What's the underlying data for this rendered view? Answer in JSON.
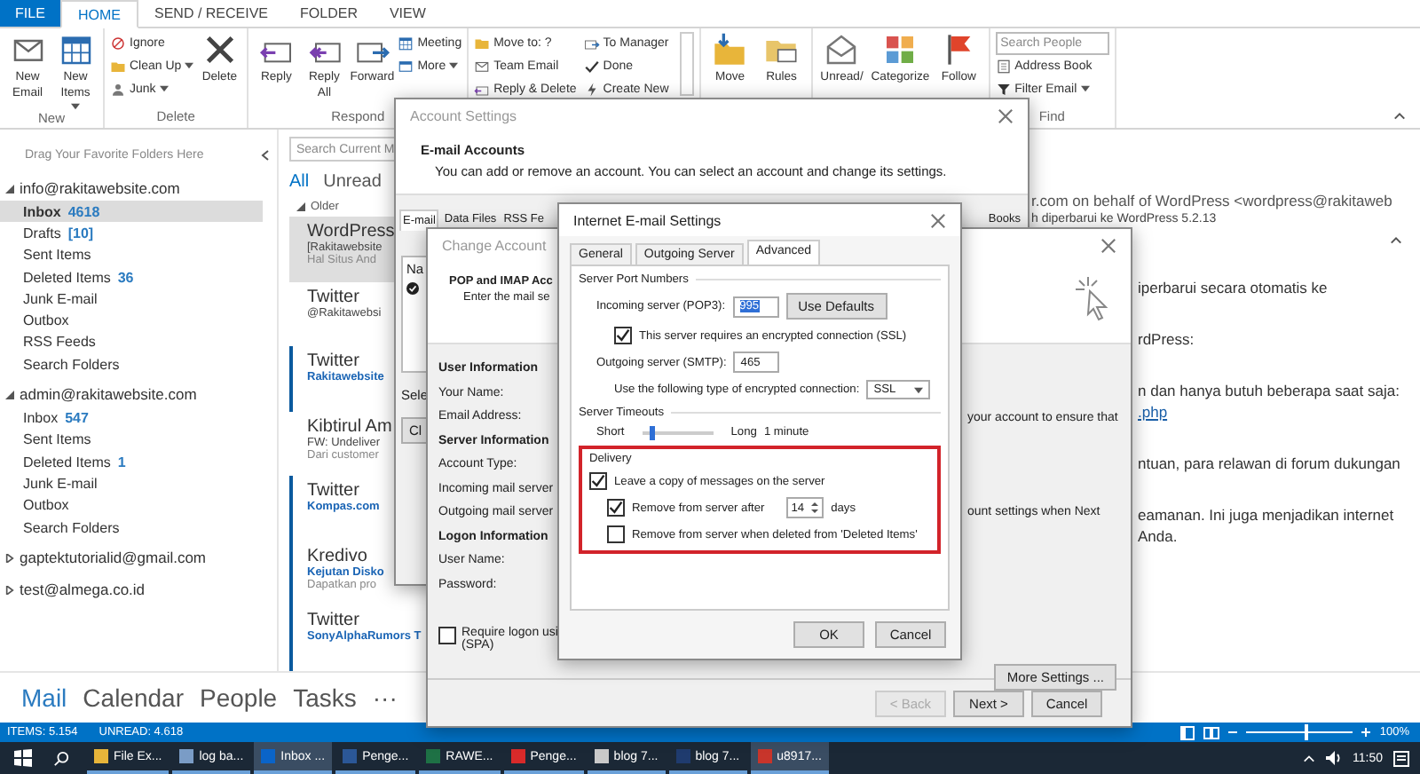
{
  "ribbon": {
    "file_tab": "FILE",
    "tabs": [
      {
        "label": "HOME",
        "selected": true
      },
      {
        "label": "SEND / RECEIVE",
        "selected": false
      },
      {
        "label": "FOLDER",
        "selected": false
      },
      {
        "label": "VIEW",
        "selected": false
      }
    ],
    "groups": [
      {
        "label": "New",
        "items": [
          {
            "kind": "large",
            "label": "New Email",
            "menu": false
          },
          {
            "kind": "large",
            "label": "New Items",
            "menu": true
          }
        ]
      },
      {
        "label": "Delete",
        "items": [
          {
            "kind": "small",
            "label": "Ignore",
            "menu": false
          },
          {
            "kind": "small",
            "label": "Clean Up",
            "menu": true
          },
          {
            "kind": "small",
            "label": "Junk",
            "menu": true
          },
          {
            "kind": "large",
            "label": "Delete",
            "menu": false
          }
        ]
      },
      {
        "label": "Respond",
        "items": [
          {
            "kind": "large",
            "label": "Reply",
            "menu": false
          },
          {
            "kind": "large",
            "label": "Reply All",
            "menu": false
          },
          {
            "kind": "large",
            "label": "Forward",
            "menu": false
          },
          {
            "kind": "small",
            "label": "Meeting",
            "menu": false
          },
          {
            "kind": "small",
            "label": "More",
            "menu": true
          }
        ]
      },
      {
        "items": [
          {
            "kind": "small",
            "label": "Move to: ?",
            "menu": false
          },
          {
            "kind": "small",
            "label": "Team Email",
            "menu": false
          },
          {
            "kind": "small",
            "label": "Reply & Delete",
            "menu": false
          },
          {
            "kind": "small",
            "label": "To Manager",
            "menu": false
          },
          {
            "kind": "small",
            "label": "Done",
            "menu": false
          },
          {
            "kind": "small",
            "label": "Create New",
            "menu": false
          }
        ]
      },
      {
        "items": [
          {
            "kind": "large",
            "label": "Move",
            "menu": false
          },
          {
            "kind": "large",
            "label": "Rules",
            "menu": false
          }
        ]
      },
      {
        "items": [
          {
            "kind": "large",
            "label": "Unread/",
            "menu": false
          },
          {
            "kind": "large",
            "label": "Categorize",
            "menu": false
          },
          {
            "kind": "large",
            "label": "Follow",
            "menu": false
          }
        ]
      },
      {
        "label": "Find",
        "items": [
          {
            "kind": "search",
            "placeholder": "Search People"
          },
          {
            "kind": "small",
            "label": "Address Book",
            "menu": false
          },
          {
            "kind": "small",
            "label": "Filter Email",
            "menu": true
          }
        ]
      }
    ]
  },
  "folder_pane": {
    "favorites_hint": "Drag Your Favorite Folders Here",
    "accounts": [
      {
        "name": "info@rakitawebsite.com",
        "expanded": true,
        "children": [
          {
            "label": "Inbox",
            "count": "4618",
            "selected": true
          },
          {
            "label": "Drafts",
            "count": "[10]",
            "selected": false
          },
          {
            "label": "Sent Items",
            "selected": false
          },
          {
            "label": "Deleted Items",
            "count": "36",
            "selected": false
          },
          {
            "label": "Junk E-mail",
            "selected": false
          },
          {
            "label": "Outbox",
            "selected": false
          },
          {
            "label": "RSS Feeds",
            "selected": false
          },
          {
            "label": "Search Folders",
            "selected": false
          }
        ]
      },
      {
        "name": "admin@rakitawebsite.com",
        "expanded": true,
        "children": [
          {
            "label": "Inbox",
            "count": "547",
            "selected": false
          },
          {
            "label": "Sent Items",
            "selected": false
          },
          {
            "label": "Deleted Items",
            "count": "1",
            "selected": false
          },
          {
            "label": "Junk E-mail",
            "selected": false
          },
          {
            "label": "Outbox",
            "selected": false
          },
          {
            "label": "Search Folders",
            "selected": false
          }
        ]
      },
      {
        "name": "gaptektutorialid@gmail.com",
        "expanded": false
      },
      {
        "name": "test@almega.co.id",
        "expanded": false
      }
    ]
  },
  "message_list": {
    "search": {
      "placeholder": "Search Current M"
    },
    "filters": [
      {
        "label": "All",
        "selected": true
      },
      {
        "label": "Unread",
        "selected": false
      }
    ],
    "group": "Older",
    "messages": [
      {
        "sender": "WordPress",
        "subject": "[Rakitawebsite",
        "preview": "Hal Situs And",
        "selected": true,
        "unread": false
      },
      {
        "sender": "Twitter",
        "subject": "@Rakitawebsi",
        "selected": false,
        "unread": false
      },
      {
        "sender": "Twitter",
        "subject": "Rakitawebsite",
        "selected": false,
        "unread": true
      },
      {
        "sender": "Kibtirul Am",
        "subject": "FW: Undeliver",
        "preview": "Dari customer",
        "selected": false,
        "unread": false
      },
      {
        "sender": "Twitter",
        "subject": "Kompas.com",
        "selected": false,
        "unread": true
      },
      {
        "sender": "Kredivo",
        "subject": "Kejutan Disko",
        "preview": "Dapatkan pro",
        "selected": false,
        "unread": true
      },
      {
        "sender": "Twitter",
        "subject": "SonyAlphaRumors T",
        "selected": false,
        "unread": true
      }
    ]
  },
  "reading_pane": {
    "from": "r.com on behalf of WordPress <wordpress@rakitaweb",
    "subject": "h diperbarui ke WordPress 5.2.13",
    "paragraphs": [
      {
        "lines": [
          "iperbarui secara otomatis ke"
        ]
      },
      {
        "lines": [
          "rdPress:"
        ]
      },
      {
        "lines": [
          "n dan hanya butuh beberapa saat saja:"
        ],
        "link": ".php"
      },
      {
        "lines": [
          "ntuan, para relawan di forum dukungan"
        ]
      },
      {
        "lines": [
          "eamanan. Ini juga menjadikan internet",
          "Anda."
        ]
      }
    ]
  },
  "nav": {
    "items": [
      {
        "label": "Mail",
        "selected": true
      },
      {
        "label": "Calendar",
        "selected": false
      },
      {
        "label": "People",
        "selected": false
      },
      {
        "label": "Tasks",
        "selected": false
      }
    ],
    "more": "···"
  },
  "status_bar": {
    "items": "ITEMS: 5.154",
    "unread": "UNREAD: 4.618",
    "zoom": "100%",
    "level": 0.55
  },
  "taskbar": {
    "apps": [
      {
        "label": "File Ex...",
        "color": "#e8b53a",
        "selected": false
      },
      {
        "label": "log ba...",
        "color": "#7a9cc6",
        "selected": false
      },
      {
        "label": "Inbox ...",
        "color": "#0a64c8",
        "selected": true
      },
      {
        "label": "Penge...",
        "color": "#2b5797",
        "selected": false
      },
      {
        "label": "RAWE...",
        "color": "#1e7145",
        "selected": false
      },
      {
        "label": "Penge...",
        "color": "#d82a2a",
        "selected": false
      },
      {
        "label": "blog 7...",
        "color": "#c9c9c9",
        "selected": false
      },
      {
        "label": "blog 7...",
        "color": "#1f3b6e",
        "selected": false
      },
      {
        "label": "u8917...",
        "color": "#c8352b",
        "selected": true
      }
    ],
    "time": "11:50"
  },
  "account_settings": {
    "title": "Account Settings",
    "heading": "E-mail Accounts",
    "description": "You can add or remove an account. You can select an account and change its settings.",
    "tabs": [
      {
        "label": "E-mail",
        "selected": true
      },
      {
        "label": "Data Files",
        "selected": false
      },
      {
        "label": "RSS Fe",
        "selected": false
      },
      {
        "label": "Books",
        "selected": false
      }
    ],
    "list_header": "Na",
    "select_hint": "Sele",
    "button": "Cl"
  },
  "change_account": {
    "title": "Change Account",
    "heading": "POP and IMAP Acc",
    "subheading": "Enter the mail se",
    "sections": [
      {
        "title": "User Information",
        "fields": [
          "Your Name:",
          "Email Address:"
        ]
      },
      {
        "title": "Server Information",
        "fields": [
          "Account Type:",
          "Incoming mail server",
          "Outgoing mail server"
        ]
      },
      {
        "title": "Logon Information",
        "fields": [
          "User Name:",
          "Password:"
        ]
      }
    ],
    "spa": {
      "label": "Require logon usi",
      "label2": "(SPA)",
      "checked": false
    },
    "notes": [
      "your account to ensure that",
      "ount settings when Next"
    ],
    "more_settings": "More Settings ...",
    "buttons": [
      {
        "label": "< Back",
        "disabled": true
      },
      {
        "label": "Next >",
        "disabled": false
      },
      {
        "label": "Cancel",
        "disabled": false
      }
    ]
  },
  "internet_settings": {
    "title": "Internet E-mail Settings",
    "tabs": [
      {
        "label": "General",
        "selected": false
      },
      {
        "label": "Outgoing Server",
        "selected": false
      },
      {
        "label": "Advanced",
        "selected": true
      }
    ],
    "ports": {
      "title": "Server Port Numbers",
      "incoming_label": "Incoming server (POP3):",
      "incoming_value": "995",
      "incoming_selected": true,
      "use_defaults": "Use Defaults",
      "ssl": {
        "label": "This server requires an encrypted connection (SSL)",
        "checked": true
      },
      "outgoing_label": "Outgoing server (SMTP):",
      "outgoing_value": "465",
      "encryption_label": "Use the following type of encrypted connection:",
      "encryption_value": "SSL"
    },
    "timeouts": {
      "title": "Server Timeouts",
      "short": "Short",
      "long": "Long",
      "level": 0.1,
      "value": "1 minute"
    },
    "delivery": {
      "title": "Delivery",
      "highlighted": true,
      "options": [
        {
          "label": "Leave a copy of messages on the server",
          "checked": true
        },
        {
          "label": "Remove from server after",
          "checked": true,
          "days": "14",
          "unit": "days"
        },
        {
          "label": "Remove from server when deleted from 'Deleted Items'",
          "checked": false
        }
      ]
    },
    "buttons": [
      "OK",
      "Cancel"
    ]
  }
}
